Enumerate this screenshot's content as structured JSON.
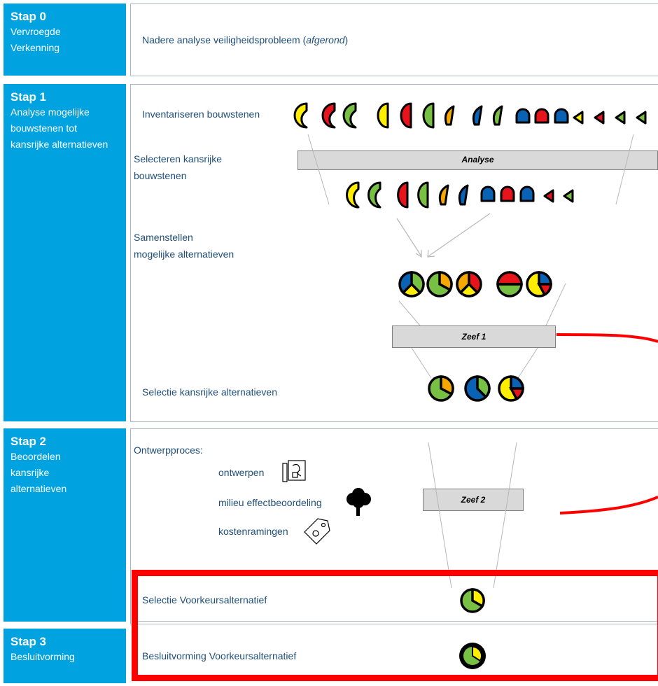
{
  "stages": [
    {
      "title": "Stap 0",
      "subtitle": "Vervroegde Verkenning"
    },
    {
      "title": "Stap 1",
      "subtitle": "Analyse mogelijke bouwstenen tot kansrijke alternatieven"
    },
    {
      "title": "Stap 2",
      "subtitle": "Beoordelen kansrijke alternatieven"
    },
    {
      "title": "Stap 3",
      "subtitle": "Besluitvorming"
    }
  ],
  "step0": {
    "text": "Nadere analyse veiligheidsprobleem (",
    "italic": "afgerond",
    "close": ")"
  },
  "step1": {
    "inventory": "Inventariseren bouwstenen",
    "select_line1": "Selecteren kansrijke",
    "select_line2": "bouwstenen",
    "compose_line1": "Samenstellen",
    "compose_line2": "mogelijke alternatieven",
    "selection": "Selectie kansrijke alternatieven",
    "analysis_bar": "Analyse",
    "sieve1": "Zeef 1"
  },
  "step2": {
    "design_process": "Ontwerpproces:",
    "designing": "ontwerpen",
    "eia": "milieu effectbeoordeling",
    "cost": "kostenramingen",
    "sieve2": "Zeef 2"
  },
  "preferred_selection": "Selectie Voorkeursalternatief",
  "preferred_decision": "Besluitvorming Voorkeursalternatief",
  "icons": [
    "design-drawing-icon",
    "tree-icon",
    "price-tag-icon"
  ],
  "colors": {
    "stage_blue": "#00a3e0",
    "text_blue": "#1f4e79",
    "highlight_red": "#ff0000",
    "yellow": "#ffee00",
    "red": "#e8141c",
    "green": "#77c043",
    "orange": "#f7a800",
    "blue": "#0a62b5"
  }
}
